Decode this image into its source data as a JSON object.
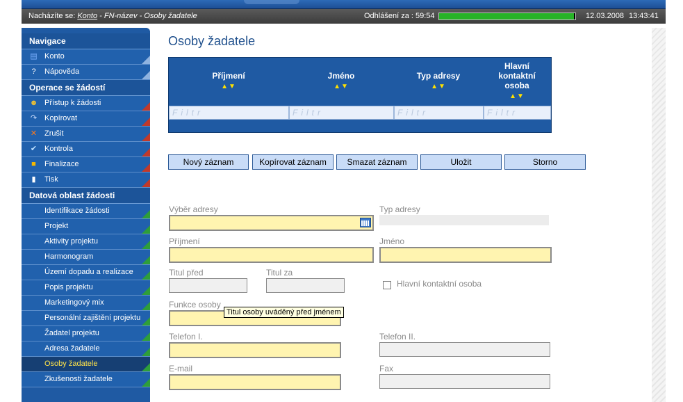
{
  "statusbar": {
    "location_prefix": "Nacházíte se: ",
    "location_link": "Konto",
    "location_rest": " - FN-název - Osoby žadatele",
    "logout_label": "Odhlášení za : 59:54",
    "session_progress": 0.99,
    "date": "12.03.2008",
    "time": "13:43:41"
  },
  "sidebar": {
    "sections": [
      {
        "title": "Navigace"
      },
      {
        "title": "Operace se žádostí"
      },
      {
        "title": "Datová oblast žádosti"
      }
    ],
    "nav_items": [
      {
        "label": "Konto",
        "icon": "account-icon"
      },
      {
        "label": "Nápověda",
        "icon": "help-icon"
      }
    ],
    "op_items": [
      {
        "label": "Přístup k žádosti",
        "icon": "users-icon"
      },
      {
        "label": "Kopírovat",
        "icon": "copy-arrow-icon"
      },
      {
        "label": "Zrušit",
        "icon": "cancel-icon"
      },
      {
        "label": "Kontrola",
        "icon": "check-icon"
      },
      {
        "label": "Finalizace",
        "icon": "lock-icon"
      },
      {
        "label": "Tisk",
        "icon": "print-icon"
      }
    ],
    "data_items": [
      {
        "label": "Identifikace žádosti"
      },
      {
        "label": "Projekt"
      },
      {
        "label": "Aktivity projektu"
      },
      {
        "label": "Harmonogram"
      },
      {
        "label": "Území dopadu a realizace"
      },
      {
        "label": "Popis projektu"
      },
      {
        "label": "Marketingový mix"
      },
      {
        "label": "Personální zajištění projektu"
      },
      {
        "label": "Žadatel projektu"
      },
      {
        "label": "Adresa žadatele"
      },
      {
        "label": "Osoby žadatele"
      },
      {
        "label": "Zkušenosti žadatele"
      }
    ],
    "active_item": "Osoby žadatele"
  },
  "main": {
    "title": "Osoby žadatele",
    "grid": {
      "columns": [
        {
          "label": "Příjmení"
        },
        {
          "label": "Jméno"
        },
        {
          "label": "Typ adresy"
        },
        {
          "label": "Hlavní kontaktní osoba"
        }
      ],
      "sort_arrows": "▲▼",
      "filter_placeholder": "Filtr"
    },
    "buttons": {
      "new": "Nový záznam",
      "copy": "Kopírovat záznam",
      "delete": "Smazat záznam",
      "save": "Uložit",
      "cancel": "Storno"
    },
    "form": {
      "address_select_label": "Výběr adresy",
      "address_type_label": "Typ adresy",
      "surname_label": "Příjmení",
      "name_label": "Jméno",
      "title_before_label": "Titul před",
      "title_after_label": "Titul za",
      "main_contact_label": "Hlavní kontaktní osoba",
      "function_label": "Funkce osoby",
      "phone1_label": "Telefon I.",
      "phone2_label": "Telefon II.",
      "email_label": "E-mail",
      "fax_label": "Fax"
    },
    "tooltip": "Titul osoby uváděný před jménem"
  }
}
